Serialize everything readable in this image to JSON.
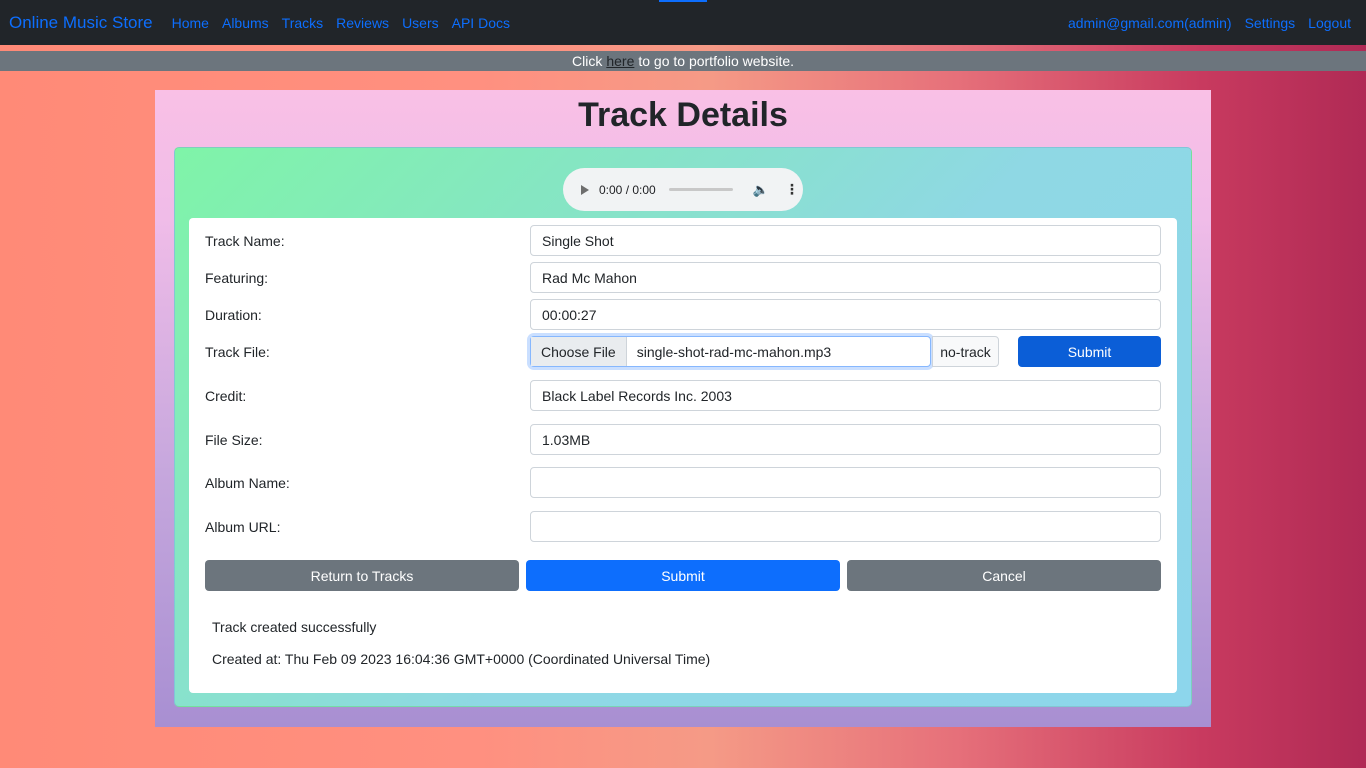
{
  "navbar": {
    "brand": "Online Music Store",
    "links": [
      "Home",
      "Albums",
      "Tracks",
      "Reviews",
      "Users",
      "API Docs"
    ],
    "user": "admin@gmail.com(admin)",
    "settings": "Settings",
    "logout": "Logout"
  },
  "banner": {
    "prefix": "Click",
    "link": "here",
    "suffix": "to go to portfolio website."
  },
  "page": {
    "title": "Track Details"
  },
  "audio_player": {
    "time": "0:00 / 0:00",
    "play_icon": "play-icon",
    "volume_icon": "volume-icon",
    "more_icon": "more-vertical-icon"
  },
  "form": {
    "fields": {
      "track_name": {
        "label": "Track Name:",
        "value": "Single Shot"
      },
      "featuring": {
        "label": "Featuring:",
        "value": "Rad Mc Mahon"
      },
      "duration": {
        "label": "Duration:",
        "value": "00:00:27"
      },
      "track_file": {
        "label": "Track File:",
        "choose": "Choose File",
        "file_name": "single-shot-rad-mc-mahon.mp3",
        "tag": "no-track",
        "submit": "Submit"
      },
      "credit": {
        "label": "Credit:",
        "value": "Black Label Records Inc. 2003"
      },
      "file_size": {
        "label": "File Size:",
        "value": "1.03MB"
      },
      "album_name": {
        "label": "Album Name:",
        "value": ""
      },
      "album_url": {
        "label": "Album URL:",
        "value": ""
      }
    },
    "buttons": {
      "return": "Return to Tracks",
      "submit": "Submit",
      "cancel": "Cancel"
    },
    "status": {
      "message": "Track created successfully",
      "created_at": "Created at: Thu Feb 09 2023 16:04:36 GMT+0000 (Coordinated Universal Time)"
    }
  },
  "colors": {
    "primary": "#0d6efd",
    "secondary": "#6c757d",
    "navbar": "#212529"
  }
}
